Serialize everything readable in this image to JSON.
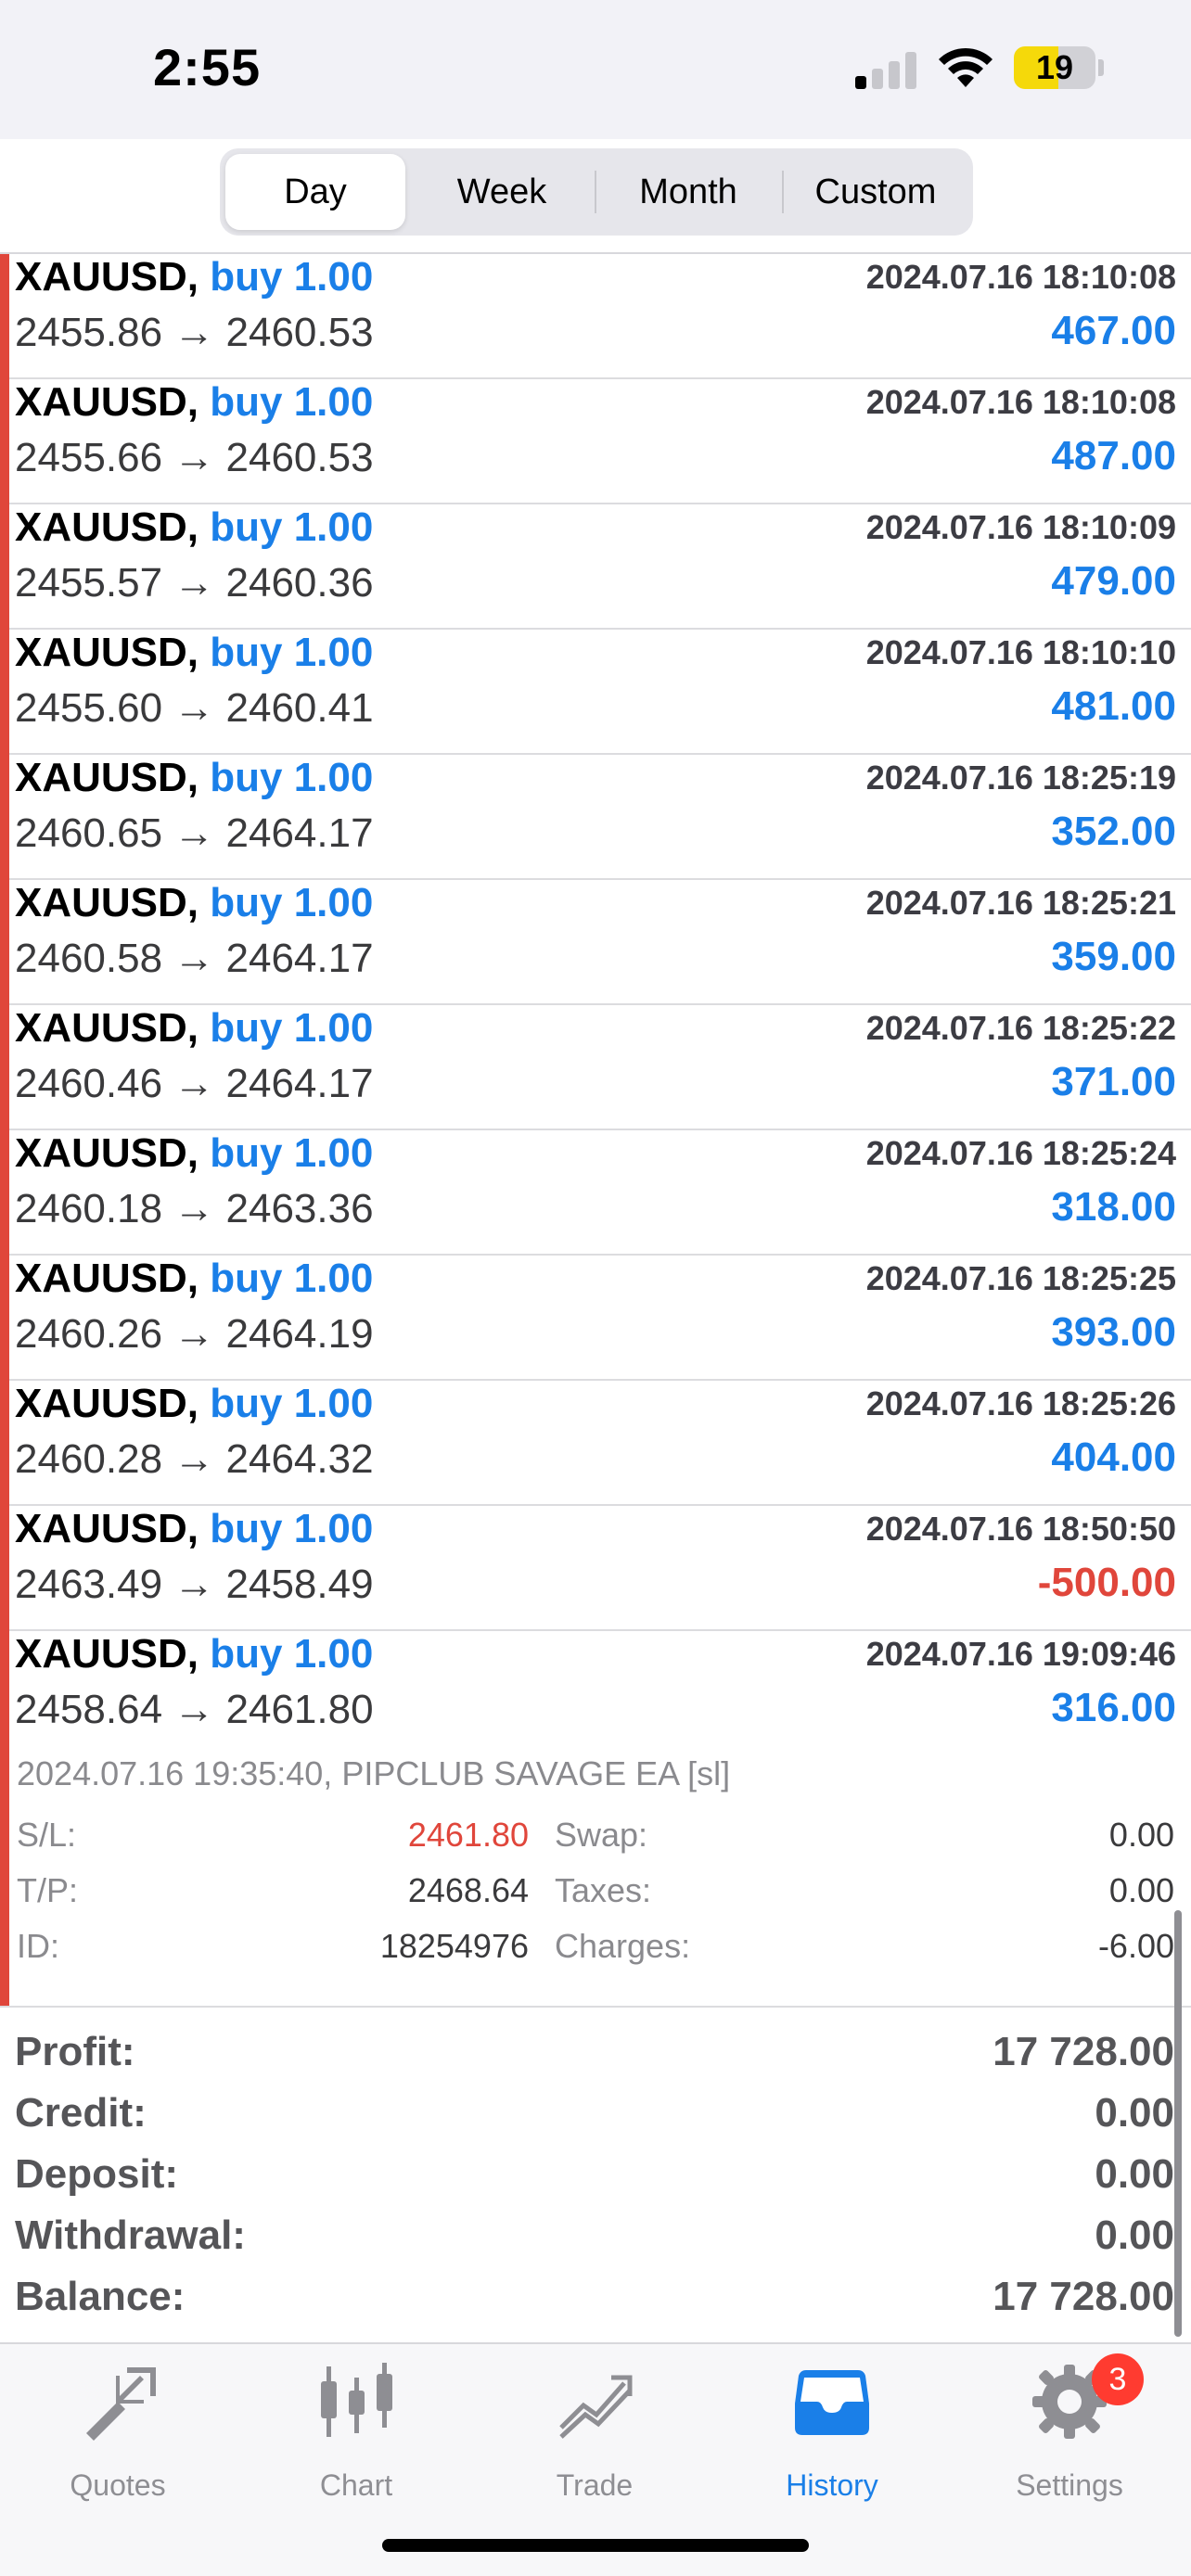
{
  "status_bar": {
    "time": "2:55",
    "battery": "19"
  },
  "period_tabs": [
    {
      "label": "Day",
      "active": true
    },
    {
      "label": "Week",
      "active": false
    },
    {
      "label": "Month",
      "active": false
    },
    {
      "label": "Custom",
      "active": false
    }
  ],
  "deals": [
    {
      "symbol": "XAUUSD,",
      "side": "buy 1.00",
      "time": "2024.07.16 18:10:08",
      "prices": "2455.86 → 2460.53",
      "profit": "467.00"
    },
    {
      "symbol": "XAUUSD,",
      "side": "buy 1.00",
      "time": "2024.07.16 18:10:08",
      "prices": "2455.66 → 2460.53",
      "profit": "487.00"
    },
    {
      "symbol": "XAUUSD,",
      "side": "buy 1.00",
      "time": "2024.07.16 18:10:09",
      "prices": "2455.57 → 2460.36",
      "profit": "479.00"
    },
    {
      "symbol": "XAUUSD,",
      "side": "buy 1.00",
      "time": "2024.07.16 18:10:10",
      "prices": "2455.60 → 2460.41",
      "profit": "481.00"
    },
    {
      "symbol": "XAUUSD,",
      "side": "buy 1.00",
      "time": "2024.07.16 18:25:19",
      "prices": "2460.65 → 2464.17",
      "profit": "352.00"
    },
    {
      "symbol": "XAUUSD,",
      "side": "buy 1.00",
      "time": "2024.07.16 18:25:21",
      "prices": "2460.58 → 2464.17",
      "profit": "359.00"
    },
    {
      "symbol": "XAUUSD,",
      "side": "buy 1.00",
      "time": "2024.07.16 18:25:22",
      "prices": "2460.46 → 2464.17",
      "profit": "371.00"
    },
    {
      "symbol": "XAUUSD,",
      "side": "buy 1.00",
      "time": "2024.07.16 18:25:24",
      "prices": "2460.18 → 2463.36",
      "profit": "318.00"
    },
    {
      "symbol": "XAUUSD,",
      "side": "buy 1.00",
      "time": "2024.07.16 18:25:25",
      "prices": "2460.26 → 2464.19",
      "profit": "393.00"
    },
    {
      "symbol": "XAUUSD,",
      "side": "buy 1.00",
      "time": "2024.07.16 18:25:26",
      "prices": "2460.28 → 2464.32",
      "profit": "404.00"
    },
    {
      "symbol": "XAUUSD,",
      "side": "buy 1.00",
      "time": "2024.07.16 18:50:50",
      "prices": "2463.49 → 2458.49",
      "profit": "-500.00"
    },
    {
      "symbol": "XAUUSD,",
      "side": "buy 1.00",
      "time": "2024.07.16 19:09:46",
      "prices": "2458.64 → 2461.80",
      "profit": "316.00"
    }
  ],
  "expanded_deal": {
    "comment": "2024.07.16 19:35:40, PIPCLUB SAVAGE EA [sl]",
    "sl_label": "S/L:",
    "sl_value": "2461.80",
    "tp_label": "T/P:",
    "tp_value": "2468.64",
    "id_label": "ID:",
    "id_value": "18254976",
    "swap_label": "Swap:",
    "swap_value": "0.00",
    "taxes_label": "Taxes:",
    "taxes_value": "0.00",
    "charges_label": "Charges:",
    "charges_value": "-6.00"
  },
  "summary": [
    {
      "label": "Profit:",
      "value": "17 728.00"
    },
    {
      "label": "Credit:",
      "value": "0.00"
    },
    {
      "label": "Deposit:",
      "value": "0.00"
    },
    {
      "label": "Withdrawal:",
      "value": "0.00"
    },
    {
      "label": "Balance:",
      "value": "17 728.00"
    }
  ],
  "tabbar": {
    "items": [
      {
        "label": "Quotes",
        "icon": "quotes-icon"
      },
      {
        "label": "Chart",
        "icon": "chart-icon"
      },
      {
        "label": "Trade",
        "icon": "trade-icon"
      },
      {
        "label": "History",
        "icon": "history-icon",
        "active": true
      },
      {
        "label": "Settings",
        "icon": "settings-icon"
      }
    ],
    "settings_badge": "3"
  },
  "colors": {
    "accent": "#1a7fe8",
    "negative": "#e0463b"
  }
}
